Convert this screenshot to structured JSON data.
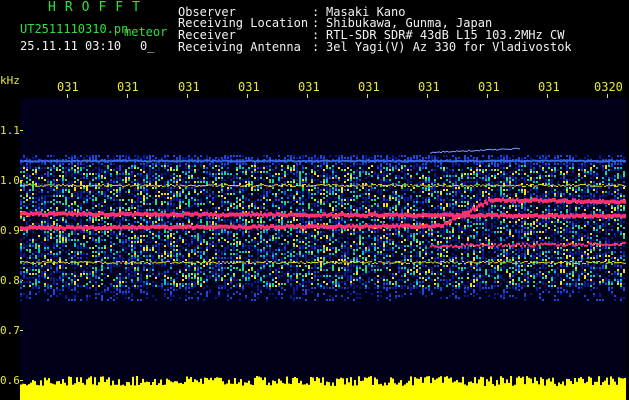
{
  "header": {
    "app_title": "HROFFT",
    "file_name": "UT2511110310.pn",
    "file_kind": "meteor",
    "date_time": "25.11.11 03:10",
    "count": "0_"
  },
  "info": [
    {
      "key": "Observer",
      "value": "Masaki Kano"
    },
    {
      "key": "Receiving Location",
      "value": "Shibukawa, Gunma, Japan"
    },
    {
      "key": "Receiver",
      "value": "RTL-SDR SDR# 43dB L15 103.2MHz CW"
    },
    {
      "key": "Receiving Antenna",
      "value": "3el Yagi(V) Az 330 for Vladivostok"
    }
  ],
  "axis": {
    "unit": "kHz",
    "x_ticks": [
      "031",
      "031",
      "031",
      "031",
      "031",
      "031",
      "031",
      "031",
      "031",
      "0320"
    ],
    "y_ticks": [
      "1.1",
      "1.0",
      "0.9",
      "0.8",
      "0.7",
      "0.6"
    ]
  },
  "colors": {
    "label_green": "#2fe03a",
    "axis_yellow": "#e8e83a",
    "background": "#000000",
    "noise_low": "#0a1a8c",
    "noise_mid": "#00c8c8",
    "noise_high": "#f0e020",
    "signal": "#ff3070",
    "bottom_bar": "#ffff00"
  }
}
